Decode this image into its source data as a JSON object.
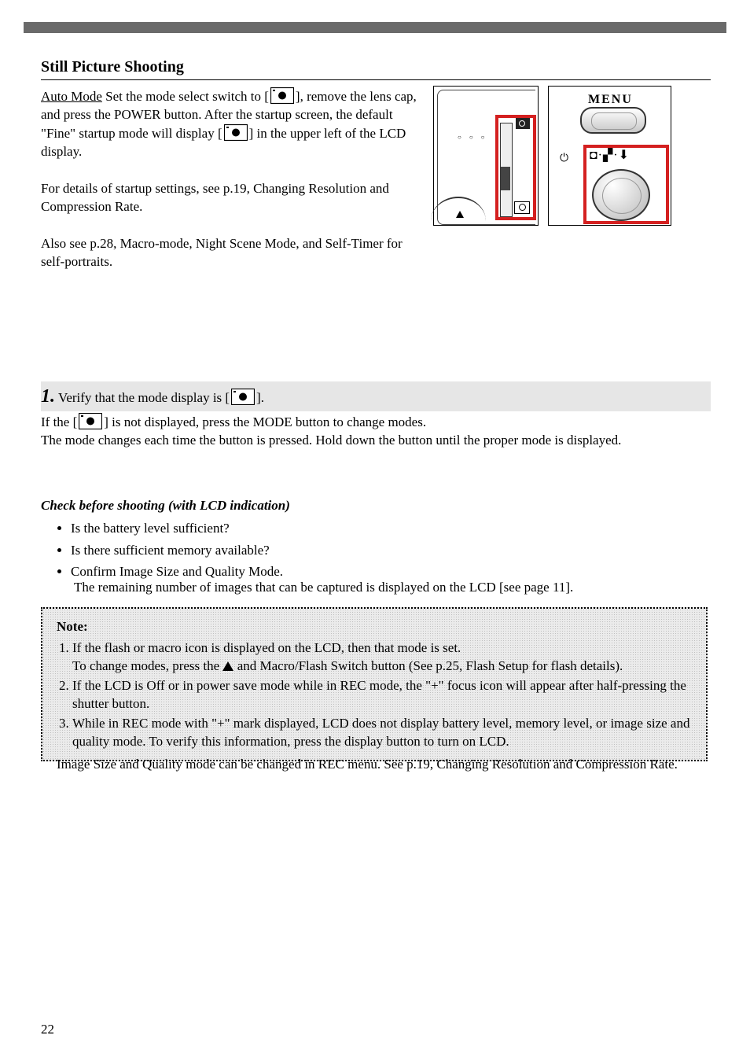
{
  "section": {
    "title": "Still Picture Shooting",
    "auto_mode_label": "Auto Mode",
    "intro_1a": " Set the mode select switch to [",
    "intro_1b": "], remove the lens cap, and press the POWER button.",
    "intro_2": "After the startup screen, the default \"Fine\" startup mode will",
    "intro_3": "display [",
    "intro_4": "] in the upper left of the LCD display.",
    "intro_gap1": "For details of startup settings, see p.19, Changing Resolution and Compression Rate.",
    "intro_gap2": "Also see p.28, Macro-mode, Night Scene Mode, and Self-Timer for self-portraits."
  },
  "step": {
    "number": "1.",
    "head_a": " Verify that the mode display is [",
    "head_b": "].",
    "body_a": "If the [",
    "body_b": "] is not displayed, press the MODE button to change modes.",
    "body_c": "The mode changes each time the button is pressed. Hold down the button until the proper mode is displayed."
  },
  "check": {
    "heading": "Check before shooting (with LCD indication)",
    "item1": "Is the battery level sufficient?",
    "item2": "Is there sufficient memory available?",
    "item3": "Confirm Image Size and Quality Mode."
  },
  "check_sub": {
    "line1": "The remaining number of images that can be captured is displayed on the LCD [see page 11].",
    "line2": "Image Size and Quality mode can be changed in REC menu. See p.19, Changing Resolution and Compression Rate."
  },
  "note": {
    "title": "Note:",
    "l1_a": "If the flash or macro icon is displayed on the LCD, then that mode is set.",
    "l1_b": "To change modes, press the ",
    "l1_c": " and Macro/Flash Switch button (See p.25, Flash Setup for flash details).",
    "l2": "If the LCD is Off or in power save mode while in REC mode, the \"+\" focus icon will appear after half-pressing the shutter button.",
    "l3": "While in REC mode with \"+\" mark displayed, LCD does not display battery level, memory level, or image size and quality mode.  To verify this information, press the display button to turn on LCD."
  },
  "page": "22",
  "fig2": {
    "menu": "MENU",
    "modes": "◘·▞·⬇",
    "power": "⏻"
  },
  "fig1": {
    "dots": "○ ○ ○"
  }
}
